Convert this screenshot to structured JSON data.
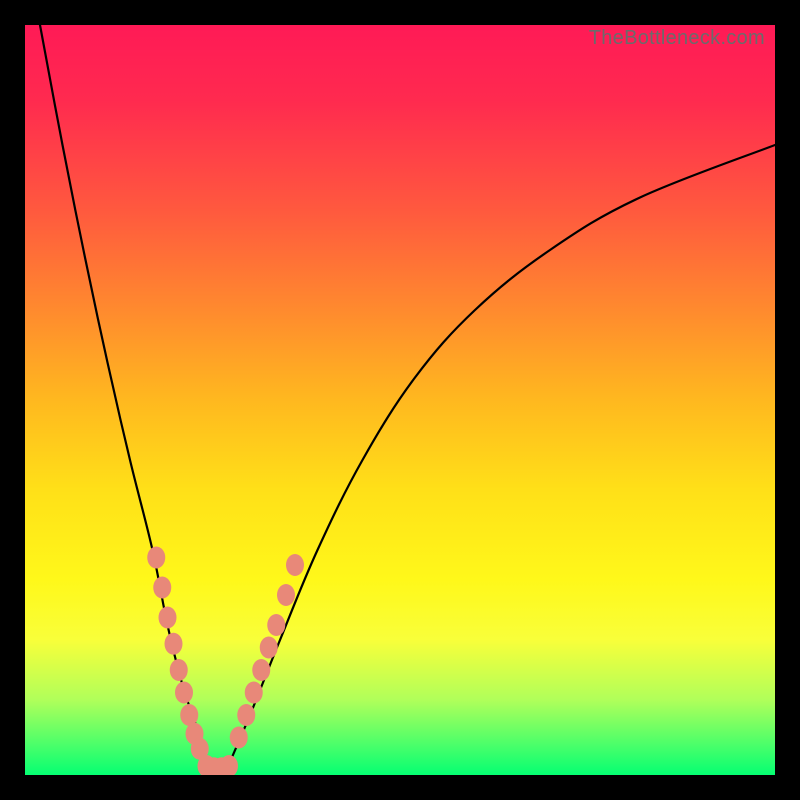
{
  "watermark": "TheBottleneck.com",
  "chart_data": {
    "type": "line",
    "title": "",
    "xlabel": "",
    "ylabel": "",
    "xlim": [
      0,
      100
    ],
    "ylim": [
      0,
      100
    ],
    "grid": false,
    "legend": false,
    "series": [
      {
        "name": "left-branch",
        "style": "curve",
        "stroke": "#000000",
        "x": [
          2,
          5,
          8,
          11,
          14,
          17,
          19,
          21,
          23,
          24.5
        ],
        "y": [
          100,
          84,
          69,
          55,
          42,
          30,
          20,
          12,
          6,
          1
        ]
      },
      {
        "name": "right-branch",
        "style": "curve",
        "stroke": "#000000",
        "x": [
          27,
          30,
          34,
          39,
          45,
          52,
          60,
          70,
          82,
          100
        ],
        "y": [
          1,
          8,
          18,
          30,
          42,
          53,
          62,
          70,
          77,
          84
        ]
      },
      {
        "name": "left-dots",
        "style": "marker",
        "stroke": "#e88879",
        "x": [
          17.5,
          18.3,
          19.0,
          19.8,
          20.5,
          21.2,
          21.9,
          22.6,
          23.3
        ],
        "y": [
          29,
          25,
          21,
          17.5,
          14,
          11,
          8,
          5.5,
          3.5
        ]
      },
      {
        "name": "right-dots",
        "style": "marker",
        "stroke": "#e88879",
        "x": [
          28.5,
          29.5,
          30.5,
          31.5,
          32.5,
          33.5,
          34.8,
          36.0
        ],
        "y": [
          5,
          8,
          11,
          14,
          17,
          20,
          24,
          28
        ]
      },
      {
        "name": "bottom-dots",
        "style": "marker",
        "stroke": "#e88879",
        "x": [
          24.2,
          25.2,
          26.2,
          27.2
        ],
        "y": [
          1.2,
          0.9,
          0.9,
          1.2
        ]
      }
    ]
  }
}
